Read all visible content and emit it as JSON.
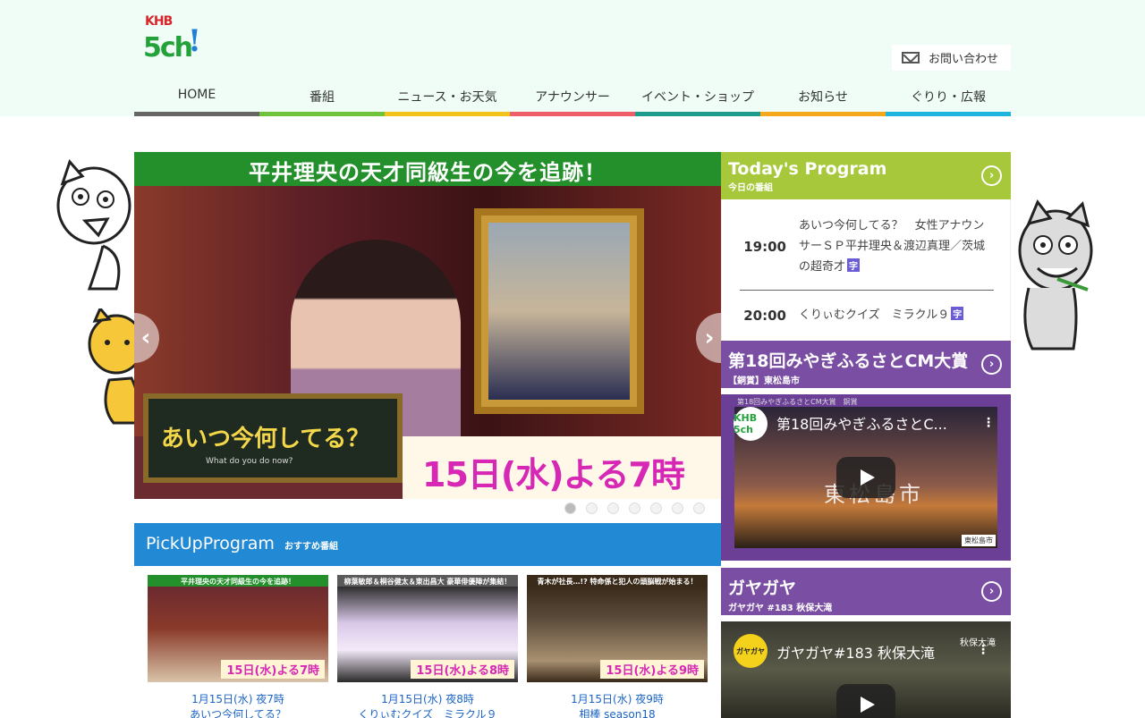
{
  "header": {
    "logo": {
      "line1": "KHB",
      "line2": "5ch",
      "mark": "!"
    },
    "contact_label": "お問い合わせ",
    "contact_icon": "mail-icon"
  },
  "nav": [
    {
      "label": "HOME",
      "color": "#666666"
    },
    {
      "label": "番組",
      "color": "#6fc33a"
    },
    {
      "label": "ニュース・お天気",
      "color": "#f2c31c"
    },
    {
      "label": "アナウンサー",
      "color": "#ee5f6a"
    },
    {
      "label": "イベント・ショップ",
      "color": "#1d9c8d"
    },
    {
      "label": "お知らせ",
      "color": "#f5a81b"
    },
    {
      "label": "ぐりり・広報",
      "color": "#1eb4de"
    }
  ],
  "hero": {
    "banner": "平井理央の天才同級生の今を追跡！",
    "board_title": "あいつ今何してる？",
    "board_sub": "What do you do now?",
    "date": "15日(水)よる7時",
    "prev": "‹",
    "next": "›",
    "slide_count": 7,
    "active_slide": 1
  },
  "pickup": {
    "title": "PickUpProgram",
    "subtitle": "おすすめ番組",
    "cards": [
      {
        "banner": "平井理央の天才同級生の今を追跡！",
        "tag": "15日(水)よる7時",
        "date": "1月15日(水) 夜7時",
        "title": "あいつ今何してる？",
        "band_color": "#23902c"
      },
      {
        "banner": "柳葉敏郎＆桐谷健太＆東出昌大 豪華俳優陣が集結！",
        "tag": "15日(水)よる8時",
        "date": "1月15日(水) 夜8時",
        "title": "くりぃむクイズ　ミラクル９",
        "band_color": "#5a5a5a"
      },
      {
        "banner": "青木が社長…!? 特命係と犯人の頭脳戦が始まる！",
        "tag": "15日(水)よる9時",
        "date": "1月15日(水) 夜9時",
        "title": "相棒 season18",
        "band_color": "#3a2a1a"
      }
    ]
  },
  "today": {
    "title": "Today's Program",
    "subtitle": "今日の番組",
    "go": "›",
    "color": "#a7c83a",
    "items": [
      {
        "time": "19:00",
        "title": "あいつ今何してる？　女性アナウンサーＳＰ平井理央＆渡辺真理／茨城の超奇才",
        "badge": "字"
      },
      {
        "time": "20:00",
        "title": "くりぃむクイズ　ミラクル９",
        "badge": "字"
      }
    ]
  },
  "cm": {
    "title": "第18回みやぎふるさとCM大賞",
    "subtitle": "【銅賞】東松島市",
    "go": "›",
    "color": "#7a4ea3",
    "video": {
      "top_line": "第18回みやぎふるさとCM大賞　銅賞",
      "channel": "KHB 5ch",
      "title": "第18回みやぎふるさとC...",
      "more": "⋮",
      "overlay": "東松島市",
      "corner": "東松島市"
    }
  },
  "gaya": {
    "title": "ガヤガヤ",
    "subtitle": "ガヤガヤ #183 秋保大滝",
    "go": "›",
    "color": "#7a4ea3",
    "video": {
      "channel": "ガヤガヤ",
      "title": "ガヤガヤ#183 秋保大滝",
      "more": "⋮",
      "location": "秋保大滝"
    }
  }
}
